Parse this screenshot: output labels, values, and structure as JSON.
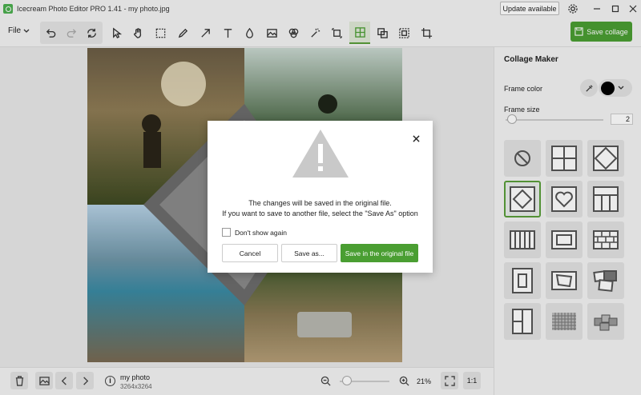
{
  "app": {
    "title": "Icecream Photo Editor PRO 1.41 - my photo.jpg"
  },
  "titlebar": {
    "update_label": "Update available"
  },
  "toolbar": {
    "file_label": "File",
    "save_collage_label": "Save collage"
  },
  "panel": {
    "title": "Collage Maker",
    "frame_color_label": "Frame color",
    "frame_color": "#000000",
    "frame_size_label": "Frame size",
    "frame_size_value": "2"
  },
  "bottombar": {
    "file_name": "my photo",
    "dimensions": "3264x3264",
    "zoom": "21%",
    "actual_size_label": "1:1"
  },
  "dialog": {
    "message_line1": "The changes will be saved in the original file.",
    "message_line2": "If you want to save to another file, select the \"Save As\" option",
    "checkbox_label": "Don't show again",
    "cancel_label": "Cancel",
    "save_as_label": "Save as...",
    "save_original_label": "Save in the original file"
  },
  "colors": {
    "accent": "#4a9e32",
    "panel_bg": "#f3f3f3"
  }
}
